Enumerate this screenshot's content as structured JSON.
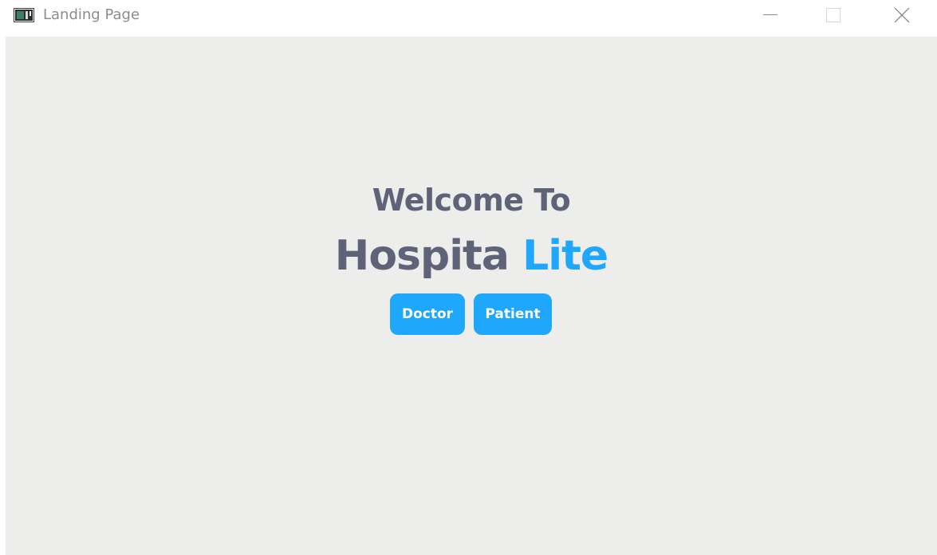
{
  "window": {
    "title": "Landing Page",
    "controls": {
      "minimize_icon": "minimize-icon",
      "maximize_icon": "maximize-icon",
      "close_icon": "close-icon"
    }
  },
  "main": {
    "welcome_text": "Welcome To",
    "brand_main": "Hospita",
    "brand_accent": "Lite",
    "buttons": {
      "doctor": "Doctor",
      "patient": "Patient"
    }
  },
  "colors": {
    "accent": "#1fa7fb",
    "heading": "#5f6377",
    "background": "#ededeb"
  }
}
